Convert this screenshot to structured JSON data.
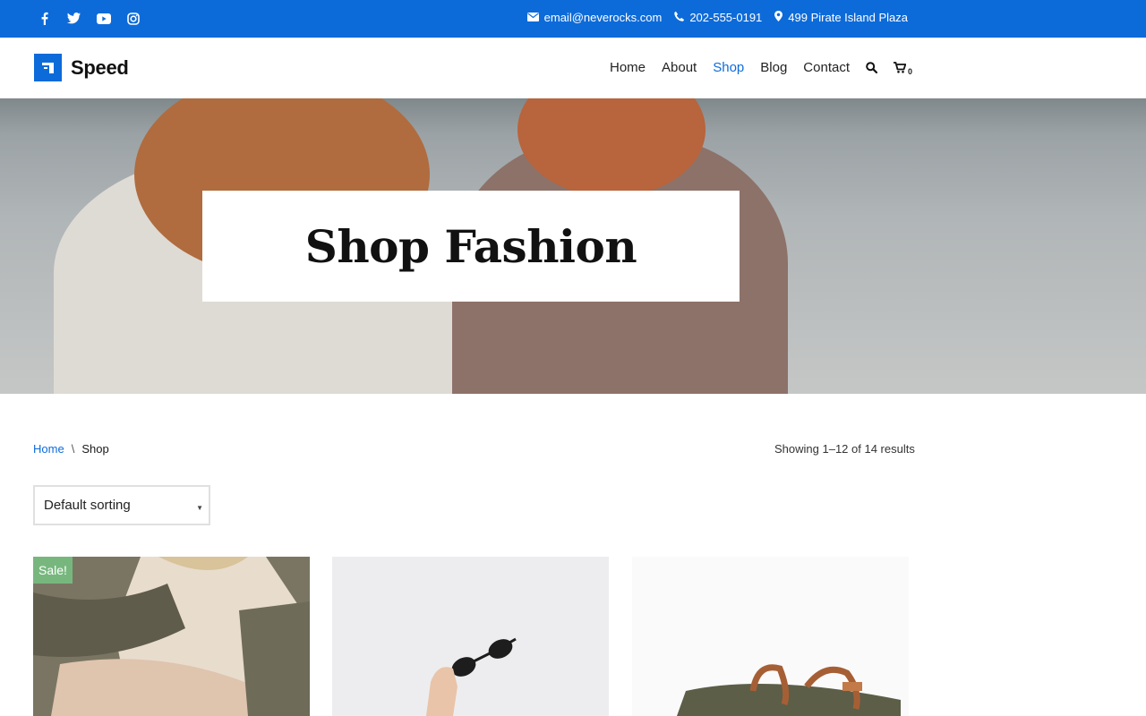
{
  "topbar": {
    "social": [
      "facebook-icon",
      "twitter-icon",
      "youtube-icon",
      "instagram-icon"
    ],
    "email": "email@neverocks.com",
    "phone": "202-555-0191",
    "address": "499 Pirate Island Plaza"
  },
  "header": {
    "logo_text": "Speed",
    "nav": [
      "Home",
      "About",
      "Shop",
      "Blog",
      "Contact"
    ],
    "active_nav": "Shop",
    "cart_count": "0"
  },
  "hero": {
    "title": "Shop Fashion"
  },
  "breadcrumb": {
    "home": "Home",
    "separator": "\\",
    "current": "Shop"
  },
  "results_text": "Showing 1–12 of 14 results",
  "sort": {
    "selected": "Default sorting"
  },
  "products": [
    {
      "badge": "Sale!",
      "image": "knit-sweater-woman"
    },
    {
      "badge": "",
      "image": "sunglasses-hand"
    },
    {
      "badge": "",
      "image": "leather-bag"
    }
  ],
  "colors": {
    "accent": "#0d6bd9",
    "sale_badge": "#77b77e"
  }
}
